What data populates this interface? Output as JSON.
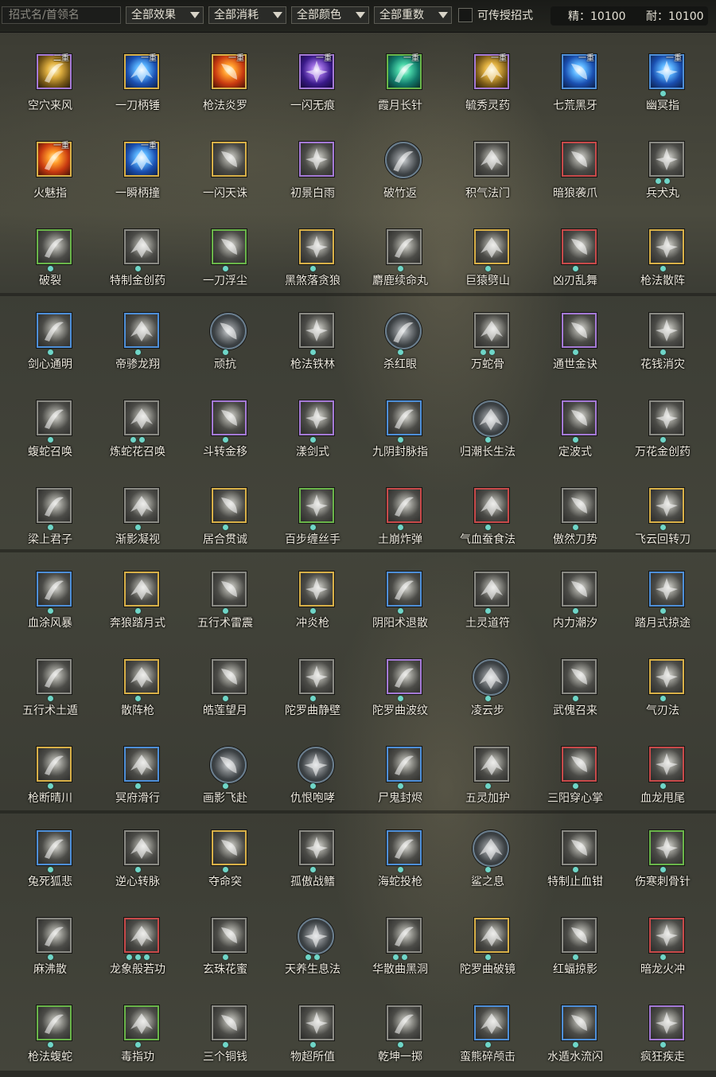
{
  "filters": {
    "search_placeholder": "招式名/首领名",
    "effect": "全部效果",
    "cost": "全部消耗",
    "color": "全部颜色",
    "tier": "全部重数",
    "transferable_label": "可传授招式"
  },
  "resources": {
    "essence": "精：10100",
    "endurance": "耐：10100"
  },
  "skills": [
    {
      "name": "空穴来风",
      "badge": "二重",
      "frame": "purple",
      "tint": "gold",
      "dots": 0
    },
    {
      "name": "一刀柄锤",
      "badge": "一重",
      "frame": "gold",
      "tint": "blue",
      "dots": 0
    },
    {
      "name": "枪法炎罗",
      "badge": "一重",
      "frame": "gold",
      "tint": "red",
      "dots": 0
    },
    {
      "name": "一闪无痕",
      "badge": "一重",
      "frame": "purple",
      "tint": "purple",
      "dots": 0
    },
    {
      "name": "霞月长针",
      "badge": "一重",
      "frame": "green",
      "tint": "teal",
      "dots": 0
    },
    {
      "name": "毓秀灵药",
      "badge": "一重",
      "frame": "purple",
      "tint": "gold",
      "dots": 0
    },
    {
      "name": "七荒黑牙",
      "badge": "一重",
      "frame": "blue",
      "tint": "blue",
      "dots": 0
    },
    {
      "name": "幽冥指",
      "badge": "一重",
      "frame": "blue",
      "tint": "blue",
      "dots": 1
    },
    {
      "name": "火魅指",
      "badge": "一重",
      "frame": "gold",
      "tint": "red",
      "dots": 0
    },
    {
      "name": "一瞬柄撞",
      "badge": "一重",
      "frame": "gold",
      "tint": "blue",
      "dots": 0
    },
    {
      "name": "一闪天诛",
      "badge": "",
      "frame": "gold",
      "tint": "",
      "dots": 0
    },
    {
      "name": "初景白雨",
      "badge": "",
      "frame": "purple",
      "tint": "",
      "dots": 0
    },
    {
      "name": "破竹返",
      "badge": "",
      "frame": "round",
      "tint": "",
      "dots": 0
    },
    {
      "name": "积气法门",
      "badge": "",
      "frame": "gray",
      "tint": "",
      "dots": 0
    },
    {
      "name": "暗狼袭爪",
      "badge": "",
      "frame": "red",
      "tint": "",
      "dots": 0
    },
    {
      "name": "兵犬丸",
      "badge": "",
      "frame": "gray",
      "tint": "",
      "dots": 2
    },
    {
      "name": "破裂",
      "badge": "",
      "frame": "green",
      "tint": "",
      "dots": 1
    },
    {
      "name": "特制金创药",
      "badge": "",
      "frame": "gray",
      "tint": "",
      "dots": 1
    },
    {
      "name": "一刀浮尘",
      "badge": "",
      "frame": "green",
      "tint": "",
      "dots": 1
    },
    {
      "name": "黑煞落贪狼",
      "badge": "",
      "frame": "gold",
      "tint": "",
      "dots": 1
    },
    {
      "name": "麝鹿续命丸",
      "badge": "",
      "frame": "gray",
      "tint": "",
      "dots": 1
    },
    {
      "name": "巨猿劈山",
      "badge": "",
      "frame": "gold",
      "tint": "",
      "dots": 1
    },
    {
      "name": "凶刃乱舞",
      "badge": "",
      "frame": "red",
      "tint": "",
      "dots": 1
    },
    {
      "name": "枪法散阵",
      "badge": "",
      "frame": "gold",
      "tint": "",
      "dots": 1
    },
    {
      "name": "剑心通明",
      "badge": "",
      "frame": "blue",
      "tint": "",
      "dots": 1
    },
    {
      "name": "帝骖龙翔",
      "badge": "",
      "frame": "blue",
      "tint": "",
      "dots": 1
    },
    {
      "name": "顽抗",
      "badge": "",
      "frame": "round",
      "tint": "",
      "dots": 1
    },
    {
      "name": "枪法铁林",
      "badge": "",
      "frame": "gray",
      "tint": "",
      "dots": 1
    },
    {
      "name": "杀红眼",
      "badge": "",
      "frame": "round",
      "tint": "",
      "dots": 1
    },
    {
      "name": "万蛇骨",
      "badge": "",
      "frame": "gray",
      "tint": "",
      "dots": 2
    },
    {
      "name": "通世金诀",
      "badge": "",
      "frame": "purple",
      "tint": "",
      "dots": 1
    },
    {
      "name": "花钱消灾",
      "badge": "",
      "frame": "gray",
      "tint": "",
      "dots": 1
    },
    {
      "name": "蝮蛇召唤",
      "badge": "",
      "frame": "gray",
      "tint": "",
      "dots": 1
    },
    {
      "name": "炼蛇花召唤",
      "badge": "",
      "frame": "gray",
      "tint": "",
      "dots": 2
    },
    {
      "name": "斗转金移",
      "badge": "",
      "frame": "purple",
      "tint": "",
      "dots": 1
    },
    {
      "name": "漾剑式",
      "badge": "",
      "frame": "purple",
      "tint": "",
      "dots": 1
    },
    {
      "name": "九阴封脉指",
      "badge": "",
      "frame": "blue",
      "tint": "",
      "dots": 1
    },
    {
      "name": "归潮长生法",
      "badge": "",
      "frame": "round",
      "tint": "",
      "dots": 1
    },
    {
      "name": "定波式",
      "badge": "",
      "frame": "purple",
      "tint": "",
      "dots": 1
    },
    {
      "name": "万花金创药",
      "badge": "",
      "frame": "gray",
      "tint": "",
      "dots": 1
    },
    {
      "name": "梁上君子",
      "badge": "",
      "frame": "gray",
      "tint": "",
      "dots": 1
    },
    {
      "name": "渐影凝视",
      "badge": "",
      "frame": "gray",
      "tint": "",
      "dots": 1
    },
    {
      "name": "居合贯诚",
      "badge": "",
      "frame": "gold",
      "tint": "",
      "dots": 1
    },
    {
      "name": "百步缠丝手",
      "badge": "",
      "frame": "green",
      "tint": "",
      "dots": 1
    },
    {
      "name": "土崩炸弹",
      "badge": "",
      "frame": "red",
      "tint": "",
      "dots": 1
    },
    {
      "name": "气血蚕食法",
      "badge": "",
      "frame": "red",
      "tint": "",
      "dots": 1
    },
    {
      "name": "傲然刀势",
      "badge": "",
      "frame": "gray",
      "tint": "",
      "dots": 1
    },
    {
      "name": "飞云回转刀",
      "badge": "",
      "frame": "gold",
      "tint": "",
      "dots": 1
    },
    {
      "name": "血涂风暴",
      "badge": "",
      "frame": "blue",
      "tint": "",
      "dots": 1
    },
    {
      "name": "奔狼踏月式",
      "badge": "",
      "frame": "gold",
      "tint": "",
      "dots": 1
    },
    {
      "name": "五行术雷震",
      "badge": "",
      "frame": "gray",
      "tint": "",
      "dots": 1
    },
    {
      "name": "冲炎枪",
      "badge": "",
      "frame": "gold",
      "tint": "",
      "dots": 1
    },
    {
      "name": "阴阳术退散",
      "badge": "",
      "frame": "blue",
      "tint": "",
      "dots": 1
    },
    {
      "name": "土灵道符",
      "badge": "",
      "frame": "gray",
      "tint": "",
      "dots": 1
    },
    {
      "name": "内力潮汐",
      "badge": "",
      "frame": "gray",
      "tint": "",
      "dots": 1
    },
    {
      "name": "踏月式掠途",
      "badge": "",
      "frame": "blue",
      "tint": "",
      "dots": 1
    },
    {
      "name": "五行术土遁",
      "badge": "",
      "frame": "gray",
      "tint": "",
      "dots": 1
    },
    {
      "name": "散阵枪",
      "badge": "",
      "frame": "gold",
      "tint": "",
      "dots": 1
    },
    {
      "name": "皓莲望月",
      "badge": "",
      "frame": "gray",
      "tint": "",
      "dots": 1
    },
    {
      "name": "陀罗曲静壁",
      "badge": "",
      "frame": "gray",
      "tint": "",
      "dots": 1
    },
    {
      "name": "陀罗曲波纹",
      "badge": "",
      "frame": "purple",
      "tint": "",
      "dots": 1
    },
    {
      "name": "凌云步",
      "badge": "",
      "frame": "round",
      "tint": "",
      "dots": 1
    },
    {
      "name": "武傀召来",
      "badge": "",
      "frame": "gray",
      "tint": "",
      "dots": 1
    },
    {
      "name": "气刃法",
      "badge": "",
      "frame": "gold",
      "tint": "",
      "dots": 1
    },
    {
      "name": "枪断晴川",
      "badge": "",
      "frame": "gold",
      "tint": "",
      "dots": 1
    },
    {
      "name": "冥府滑行",
      "badge": "",
      "frame": "blue",
      "tint": "",
      "dots": 1
    },
    {
      "name": "画影飞赴",
      "badge": "",
      "frame": "round",
      "tint": "",
      "dots": 1
    },
    {
      "name": "仇恨咆哮",
      "badge": "",
      "frame": "round",
      "tint": "",
      "dots": 1
    },
    {
      "name": "尸鬼封烬",
      "badge": "",
      "frame": "blue",
      "tint": "",
      "dots": 1
    },
    {
      "name": "五灵加护",
      "badge": "",
      "frame": "gray",
      "tint": "",
      "dots": 1
    },
    {
      "name": "三阳穿心掌",
      "badge": "",
      "frame": "red",
      "tint": "",
      "dots": 1
    },
    {
      "name": "血龙甩尾",
      "badge": "",
      "frame": "red",
      "tint": "",
      "dots": 1
    },
    {
      "name": "兔死狐悲",
      "badge": "",
      "frame": "blue",
      "tint": "",
      "dots": 1
    },
    {
      "name": "逆心转脉",
      "badge": "",
      "frame": "gray",
      "tint": "",
      "dots": 1
    },
    {
      "name": "夺命突",
      "badge": "",
      "frame": "gold",
      "tint": "",
      "dots": 1
    },
    {
      "name": "孤傲战鳍",
      "badge": "",
      "frame": "gray",
      "tint": "",
      "dots": 1
    },
    {
      "name": "海蛇投枪",
      "badge": "",
      "frame": "blue",
      "tint": "",
      "dots": 1
    },
    {
      "name": "鲨之息",
      "badge": "",
      "frame": "round",
      "tint": "",
      "dots": 1
    },
    {
      "name": "特制止血钳",
      "badge": "",
      "frame": "gray",
      "tint": "",
      "dots": 1
    },
    {
      "name": "伤寒刺骨针",
      "badge": "",
      "frame": "green",
      "tint": "",
      "dots": 1
    },
    {
      "name": "麻沸散",
      "badge": "",
      "frame": "gray",
      "tint": "",
      "dots": 1
    },
    {
      "name": "龙象般若功",
      "badge": "",
      "frame": "red",
      "tint": "",
      "dots": 3
    },
    {
      "name": "玄珠花蜜",
      "badge": "",
      "frame": "gray",
      "tint": "",
      "dots": 1
    },
    {
      "name": "天养生息法",
      "badge": "",
      "frame": "round",
      "tint": "",
      "dots": 2
    },
    {
      "name": "华散曲黑洞",
      "badge": "",
      "frame": "gray",
      "tint": "",
      "dots": 2
    },
    {
      "name": "陀罗曲破镜",
      "badge": "",
      "frame": "gold",
      "tint": "",
      "dots": 1
    },
    {
      "name": "红蝠掠影",
      "badge": "",
      "frame": "gray",
      "tint": "",
      "dots": 1
    },
    {
      "name": "暗龙火冲",
      "badge": "",
      "frame": "red",
      "tint": "",
      "dots": 1
    },
    {
      "name": "枪法蝮蛇",
      "badge": "",
      "frame": "green",
      "tint": "",
      "dots": 1
    },
    {
      "name": "毒指功",
      "badge": "",
      "frame": "green",
      "tint": "",
      "dots": 1
    },
    {
      "name": "三个铜钱",
      "badge": "",
      "frame": "gray",
      "tint": "",
      "dots": 1
    },
    {
      "name": "物超所值",
      "badge": "",
      "frame": "gray",
      "tint": "",
      "dots": 1
    },
    {
      "name": "乾坤一掷",
      "badge": "",
      "frame": "gray",
      "tint": "",
      "dots": 1
    },
    {
      "name": "蛮熊碎颅击",
      "badge": "",
      "frame": "blue",
      "tint": "",
      "dots": 1
    },
    {
      "name": "水遁水流闪",
      "badge": "",
      "frame": "blue",
      "tint": "",
      "dots": 1
    },
    {
      "name": "疯狂疾走",
      "badge": "",
      "frame": "purple",
      "tint": "",
      "dots": 1
    }
  ],
  "colors": {
    "dot": "#6fd6c8",
    "frame_blue": "#4e8fd8",
    "frame_green": "#6ab54a",
    "frame_purple": "#a57ad6",
    "frame_gold": "#d8b048",
    "frame_red": "#c84a4a"
  }
}
